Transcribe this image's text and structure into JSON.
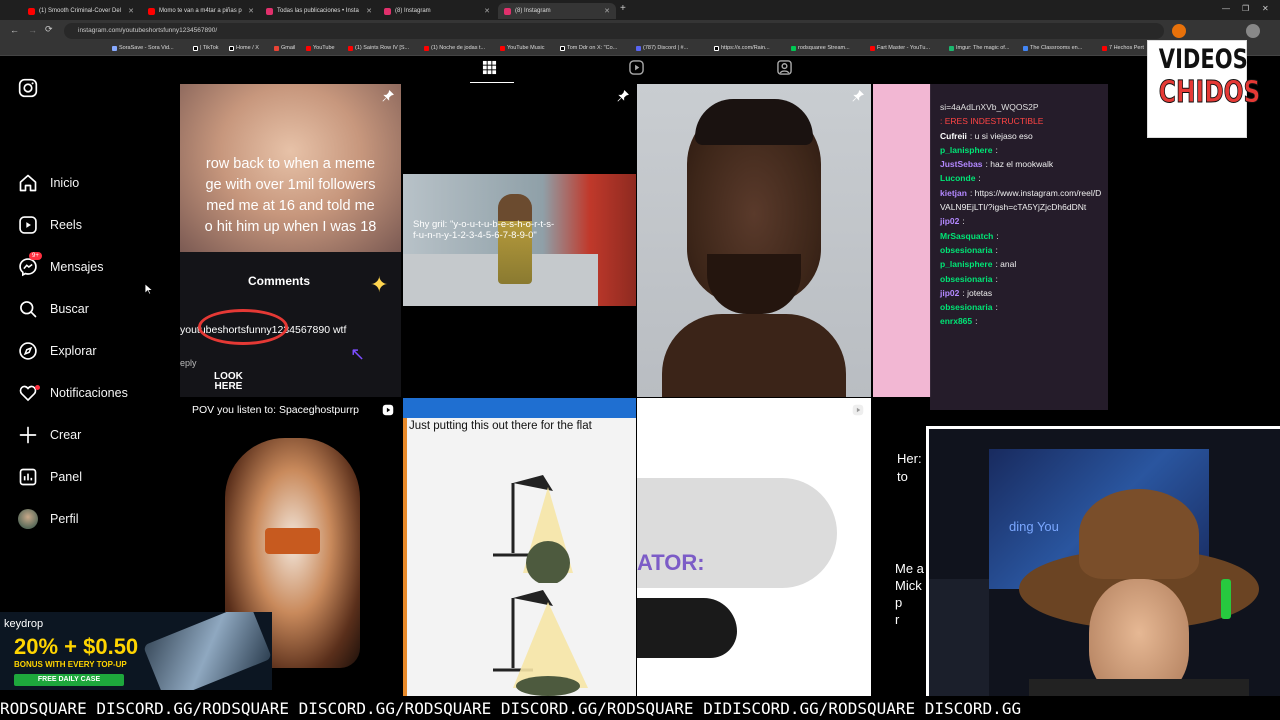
{
  "browser": {
    "tabs": [
      {
        "label": "(1) Smooth Criminal-Cover Del",
        "color": "#ff0000"
      },
      {
        "label": "Momo te van a m4tar a piñas p",
        "color": "#ff0000"
      },
      {
        "label": "Todas las publicaciones • Insta",
        "color": "#e1306c"
      },
      {
        "label": "(8) Instagram",
        "color": "#e1306c"
      },
      {
        "label": "(8) Instagram",
        "color": "#e1306c"
      }
    ],
    "url": "instagram.com/youtubeshortsfunny1234567890/",
    "bookmarks": [
      "SoraSave - Sora Vid...",
      "| TikTok",
      "Home / X",
      "Gmail",
      "YouTube",
      "(1) Saints Row IV [S...",
      "(1) Noche de jodas t...",
      "YouTube Music",
      "Tom Ddr on X: \"Co...",
      "(787) Discord | #...",
      "https://x.com/Rain...",
      "rodsquaree Stream...",
      "Fart Master - YouTu...",
      "Imgur: The magic of...",
      "The Classrooms en...",
      "7 Hechos Pert"
    ]
  },
  "sidebar": {
    "items": [
      {
        "label": "Inicio"
      },
      {
        "label": "Reels"
      },
      {
        "label": "Mensajes",
        "badge": "9+"
      },
      {
        "label": "Buscar"
      },
      {
        "label": "Explorar"
      },
      {
        "label": "Notificaciones"
      },
      {
        "label": "Crear"
      },
      {
        "label": "Panel"
      },
      {
        "label": "Perfil"
      }
    ]
  },
  "grid": {
    "tile1": {
      "text": "row back to when a meme\nge with over 1mil followers\nmed me at 16 and told me\no hit him up when I was 18",
      "comments": "Comments",
      "handle": "youtubeshortsfunny1234567890 wtf",
      "look": "LOOK\nHERE",
      "reply": "eply"
    },
    "tile2": {
      "text": "Shy gril: \"y-o-u-t-u-b-e-s-h-o-r-t-s-\nf-u-n-n-y-1-2-3-4-5-6-7-8-9-0\""
    },
    "tile5": {
      "text": "POV you listen to: Spaceghostpurrp"
    },
    "tile6": {
      "text": "Just putting this out there for the flat"
    },
    "tile7": {
      "text": "ATOR:"
    },
    "tile8": {
      "text": "Her:\nto",
      "text2": "Me a\nMick\np\nr"
    }
  },
  "chat": {
    "messages": [
      {
        "user": "",
        "text": "si=4aAdLnXVb_WQOS2P",
        "color": "#e0e0e0"
      },
      {
        "user": "",
        "text": ": ERES INDESTRUCTIBLE",
        "color": "#ff4444"
      },
      {
        "user": "Cufreii",
        "text": ": u si viejaso eso",
        "color": "#ffffff"
      },
      {
        "user": "p_lanisphere",
        "text": ":",
        "color": "#00e676"
      },
      {
        "user": "JustSebas",
        "text": ": haz el mookwalk",
        "color": "#b388ff"
      },
      {
        "user": "Luconde",
        "text": ":",
        "color": "#00e676"
      },
      {
        "user": "kietjan",
        "text": ": https://www.instagram.com/reel/DVALN9EjLTI/?igsh=cTA5YjZjcDh6dDNt",
        "color": "#b388ff"
      },
      {
        "user": "jip02",
        "text": ":",
        "color": "#b388ff"
      },
      {
        "user": "MrSasquatch",
        "text": ":",
        "color": "#00e676"
      },
      {
        "user": "obsesionaria",
        "text": ":",
        "color": "#00e676"
      },
      {
        "user": "p_lanisphere",
        "text": ": anal",
        "color": "#00e676"
      },
      {
        "user": "obsesionaria",
        "text": ":",
        "color": "#00e676"
      },
      {
        "user": "jip02",
        "text": ": jotetas",
        "color": "#b388ff"
      },
      {
        "user": "obsesionaria",
        "text": ":",
        "color": "#00e676"
      },
      {
        "user": "enrx865",
        "text": ":",
        "color": "#00e676"
      }
    ]
  },
  "logo": {
    "line1": "VIDEOS",
    "line2": "CHIDOS"
  },
  "ad": {
    "brand": "keydrop",
    "promo": "20% + $0.50",
    "sub": "BONUS WITH EVERY TOP-UP",
    "cta": "FREE DAILY CASE"
  },
  "webcam": {
    "sign": "ding You"
  },
  "ticker": {
    "text": "RODSQUARE DISCORD.GG/RODSQUARE DISCORD.GG/RODSQUARE DISCORD.GG/RODSQUARE DIDISCORD.GG/RODSQUARE DISCORD.GG"
  }
}
